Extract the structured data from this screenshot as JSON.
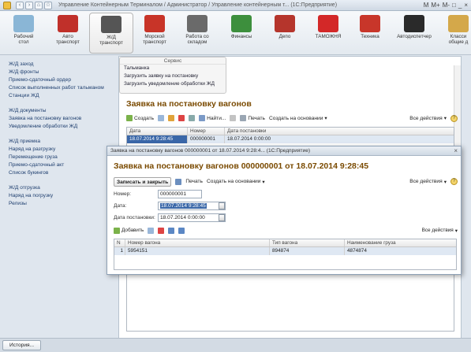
{
  "window": {
    "title": "Управление Контейнерным Терминалом / Администратор / Управление контейнерным т... (1С:Предприятие)",
    "controls": [
      "M",
      "M+",
      "M-",
      "□",
      "_",
      "×"
    ]
  },
  "toolbar": [
    {
      "label": "Рабочий\nстол",
      "icon": "desktop-icon",
      "color": "#8ab6d6"
    },
    {
      "label": "Авто\nтранспорт",
      "icon": "truck-icon",
      "color": "#c0302a"
    },
    {
      "label": "Ж/Д\nтранспорт",
      "icon": "train-icon",
      "color": "#555555",
      "active": true
    },
    {
      "label": "Морской\nтранспорт",
      "icon": "ship-icon",
      "color": "#c83428"
    },
    {
      "label": "Работа со\nскладом",
      "icon": "warehouse-icon",
      "color": "#6a6a6a"
    },
    {
      "label": "Финансы",
      "icon": "money-icon",
      "color": "#3d8f3d"
    },
    {
      "label": "Депо",
      "icon": "container-icon",
      "color": "#b5352c"
    },
    {
      "label": "ТАМОЖНЯ",
      "icon": "customs-icon",
      "color": "#d32828"
    },
    {
      "label": "Техника",
      "icon": "crane-icon",
      "color": "#c8362a"
    },
    {
      "label": "Автодиспетчер",
      "icon": "traffic-light-icon",
      "color": "#2a2a2a"
    },
    {
      "label": "Класси\nобщие д",
      "icon": "book-icon",
      "color": "#d4a84a"
    }
  ],
  "leftnav": {
    "items": [
      "Ж/Д заход",
      "Ж/Д фронты",
      "Приемо-сдаточный ордер",
      "Список выполненных работ тальманом",
      "Станции ЖД"
    ],
    "groups": [
      {
        "head": "Ж/Д документы",
        "items": [
          "Заявка на постановку вагонов",
          "Уведомление обработки ЖД"
        ]
      },
      {
        "head": "Ж/Д приемка",
        "items": [
          "Наряд на разгрузку",
          "Перемещение груза",
          "Приемо-сдаточный акт",
          "Список букингов"
        ]
      },
      {
        "head": "Ж/Д отгрузка",
        "items": [
          "Наряд на погрузку",
          "Релизы"
        ]
      }
    ]
  },
  "service": {
    "title": "Сервис",
    "items": [
      "Тальманка",
      "Загрузить заявку на постановку",
      "Загрузить уведомление обработки ЖД"
    ]
  },
  "list": {
    "title": "Заявка на постановку вагонов",
    "create": "Создать",
    "find": "Найти...",
    "print": "Печать",
    "create_based": "Создать на основании",
    "all_actions": "Все действия",
    "columns": [
      "Дата",
      "Номер",
      "Дата постановки"
    ],
    "rows": [
      [
        "18.07.2014 9:28:45",
        "000000001",
        "18.07.2014 0:00:00"
      ]
    ]
  },
  "dialog": {
    "bar": "Заявка на постановку вагонов 000000001 от 18.07.2014 9:28:4... (1С:Предприятие)",
    "title": "Заявка на постановку вагонов 000000001 от 18.07.2014 9:28:45",
    "save_close": "Записать и закрыть",
    "print": "Печать",
    "create_based": "Создать на основании",
    "all_actions": "Все действия",
    "number_label": "Номер:",
    "number": "000000001",
    "date_label": "Дата:",
    "date": "18.07.2014 9:28:45",
    "date_post_label": "Дата постановки:",
    "date_post": "18.07.2014 0:00:00",
    "add": "Добавить",
    "all_actions2": "Все действия",
    "columns": [
      "N",
      "Номер вагона",
      "Тип вагона",
      "Наименование груза"
    ],
    "rows": [
      [
        "1",
        "5954151",
        "894874",
        "4874874"
      ]
    ]
  },
  "statusbar": {
    "history": "История..."
  }
}
